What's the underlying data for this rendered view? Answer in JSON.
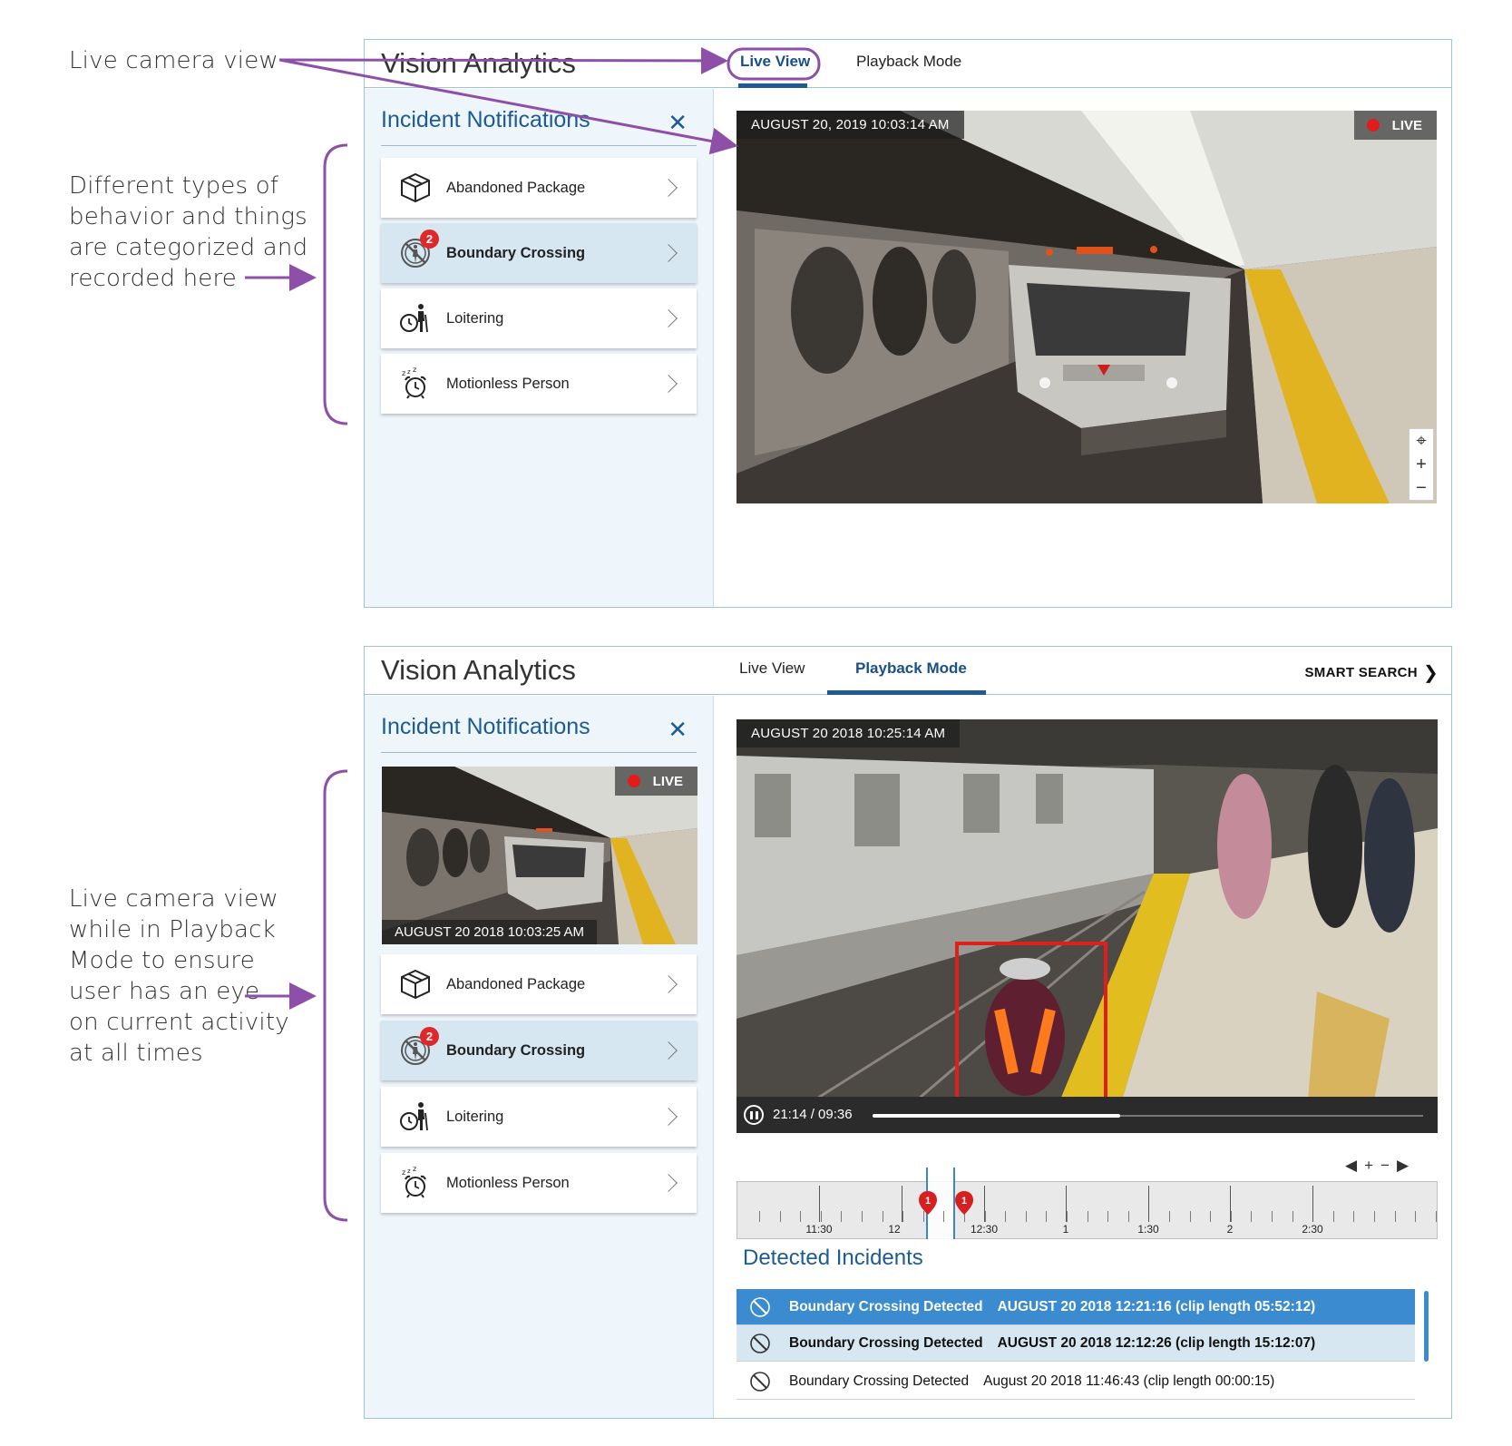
{
  "annotations": {
    "live_camera_view": "Live camera view",
    "categories": [
      "Different types of",
      "behavior and things",
      "are categorized and",
      "recorded here"
    ],
    "playback_live": [
      "Live camera view",
      "while in Playback",
      "Mode to ensure",
      "user has an eye",
      "on current activity",
      "at all times"
    ]
  },
  "colors": {
    "accent": "#1c5b94",
    "annotation": "#8e4fa8",
    "live_dot": "#e21b1b",
    "selected_row": "#3a8bd0",
    "selected_card": "#d6e7f2"
  },
  "top_panel": {
    "app_title": "Vision Analytics",
    "tabs": [
      {
        "label": "Live View",
        "active": true
      },
      {
        "label": "Playback Mode",
        "active": false
      }
    ],
    "sidebar_title": "Incident Notifications",
    "close_icon": "close-icon",
    "categories": [
      {
        "label": "Abandoned Package",
        "icon": "package-icon"
      },
      {
        "label": "Boundary Crossing",
        "icon": "no-entry-icon",
        "badge": "2",
        "selected": true
      },
      {
        "label": "Loitering",
        "icon": "loitering-icon"
      },
      {
        "label": "Motionless Person",
        "icon": "alarm-clock-icon"
      }
    ],
    "video": {
      "timestamp": "AUGUST 20, 2019 10:03:14 AM",
      "live_label": "LIVE",
      "zoom": [
        "⌖",
        "+",
        "−"
      ]
    }
  },
  "bottom_panel": {
    "app_title": "Vision Analytics",
    "tabs": [
      {
        "label": "Live View",
        "active": false
      },
      {
        "label": "Playback Mode",
        "active": true
      }
    ],
    "smart_search": "SMART SEARCH",
    "sidebar_title": "Incident Notifications",
    "live_thumb": {
      "live_label": "LIVE",
      "timestamp": "AUGUST 20 2018 10:03:25 AM"
    },
    "categories": [
      {
        "label": "Abandoned Package",
        "icon": "package-icon"
      },
      {
        "label": "Boundary Crossing",
        "icon": "no-entry-icon",
        "badge": "2",
        "selected": true
      },
      {
        "label": "Loitering",
        "icon": "loitering-icon"
      },
      {
        "label": "Motionless Person",
        "icon": "alarm-clock-icon"
      }
    ],
    "video": {
      "timestamp": "AUGUST 20 2018 10:25:14 AM",
      "playback_time": "21:14 / 09:36",
      "progress": 0.45
    },
    "timeline": {
      "controls": [
        "◀",
        "+",
        "−",
        "▶"
      ],
      "labels": [
        "11:30",
        "12",
        "12:30",
        "1",
        "1:30",
        "2",
        "2:30"
      ],
      "markers": [
        "1",
        "1"
      ]
    },
    "detected_title": "Detected Incidents",
    "incidents": [
      {
        "type": "Boundary Crossing Detected",
        "detail": "AUGUST 20 2018 12:21:16 (clip length 05:52:12)"
      },
      {
        "type": "Boundary Crossing Detected",
        "detail": "AUGUST 20 2018 12:12:26 (clip length 15:12:07)"
      },
      {
        "type": "Boundary Crossing Detected",
        "detail": "August 20 2018 11:46:43 (clip length 00:00:15)"
      }
    ]
  }
}
